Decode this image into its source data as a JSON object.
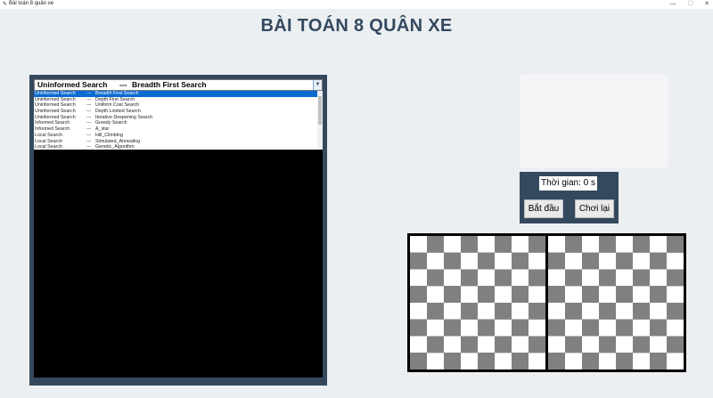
{
  "window": {
    "title": "Bài toán 8 quân xe",
    "controls": {
      "minimize": "—",
      "maximize": "☐",
      "close": "✕"
    }
  },
  "header": {
    "title": "BÀI TOÁN 8 QUÂN XE"
  },
  "algorithm_select": {
    "selected_category": "Uninformed Search",
    "separator": "---",
    "selected_algorithm": "Breadth First Search",
    "options": [
      {
        "category": "Uninformed Search",
        "separator": "---",
        "algorithm": "Breadth First Search",
        "selected": true
      },
      {
        "category": "Uninformed Search",
        "separator": "---",
        "algorithm": "Depth First Search"
      },
      {
        "category": "Uninformed Search",
        "separator": "---",
        "algorithm": "Uniform Cost Search"
      },
      {
        "category": "Uninformed Search",
        "separator": "---",
        "algorithm": "Depth Limited Search"
      },
      {
        "category": "Uninformed Search",
        "separator": "---",
        "algorithm": "Iterative Deepening Search"
      },
      {
        "category": "Informed Search",
        "separator": "---",
        "algorithm": "Greedy Search"
      },
      {
        "category": "Informed Search",
        "separator": "---",
        "algorithm": "A_star"
      },
      {
        "category": "Local Search",
        "separator": "---",
        "algorithm": "Hill_Climbing"
      },
      {
        "category": "Local Search",
        "separator": "---",
        "algorithm": "Simulated_Annealing"
      },
      {
        "category": "Local Search",
        "separator": "---",
        "algorithm": "Genetic_Algorithm"
      }
    ]
  },
  "controls": {
    "timer_text": "Thời gian: 0 s",
    "start_label": "Bắt đầu",
    "reset_label": "Chơi lại"
  },
  "boards": {
    "size": 8,
    "light_color": "#ffffff",
    "dark_color": "#808080"
  }
}
